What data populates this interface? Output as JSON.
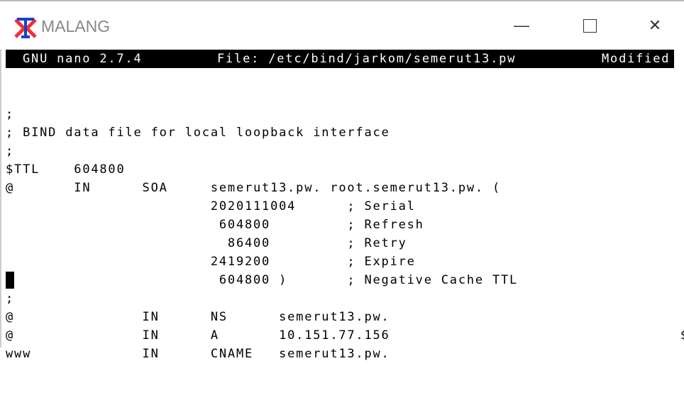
{
  "window": {
    "title": "MALANG",
    "controls": [
      "minimize",
      "maximize",
      "close"
    ]
  },
  "nano": {
    "version": "GNU nano 2.7.4",
    "file": "File: /etc/bind/jarkom/semerut13.pw",
    "status": "Modified"
  },
  "lines": [
    ";",
    "; BIND data file for local loopback interface",
    ";",
    "$TTL    604800",
    "@       IN      SOA     semerut13.pw. root.semerut13.pw. (",
    "                        2020111004      ; Serial",
    "                         604800         ; Refresh",
    "                          86400         ; Retry",
    "                        2419200         ; Expire",
    "                         604800 )       ; Negative Cache TTL",
    ";",
    "@               IN      NS      semerut13.pw.",
    "@               IN      A       10.151.77.156                                  $",
    "www             IN      CNAME   semerut13.pw."
  ]
}
